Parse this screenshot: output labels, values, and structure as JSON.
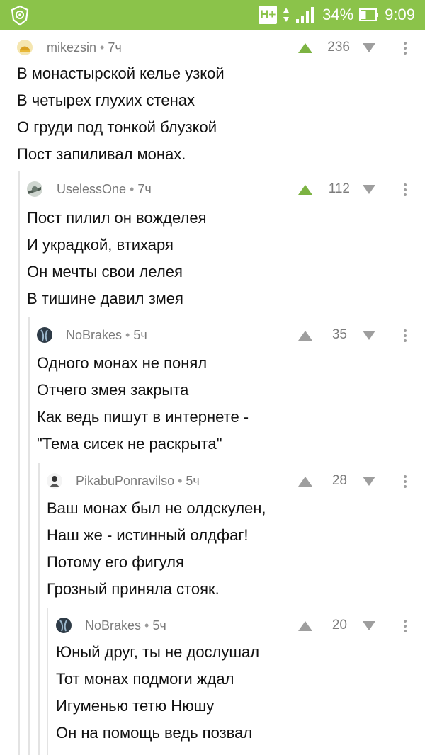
{
  "status_bar": {
    "network": "H+",
    "battery_percent": "34%",
    "time": "9:09",
    "battery_level": 0.34
  },
  "comments": [
    {
      "author": "mikezsin",
      "age": "7ч",
      "rating": "236",
      "upvote_active": true,
      "lines": [
        "В монастырской келье узкой",
        "В четырех глухих стенах",
        "О груди под тонкой блузкой",
        "Пост запиливал монах."
      ]
    },
    {
      "author": "UselessOne",
      "age": "7ч",
      "rating": "112",
      "upvote_active": true,
      "lines": [
        "Пост пилил он вожделея",
        "И украдкой, втихаря",
        "Он мечты свои лелея",
        "В тишине давил змея"
      ]
    },
    {
      "author": "NoBrakes",
      "age": "5ч",
      "rating": "35",
      "upvote_active": false,
      "lines": [
        "Одного монах не понял",
        "Отчего змея закрыта",
        "Как ведь пишут в интернете -",
        "\"Тема сисек не раскрыта\""
      ]
    },
    {
      "author": "PikabuPonravilso",
      "age": "5ч",
      "rating": "28",
      "upvote_active": false,
      "lines": [
        "Ваш монах был не олдскулен,",
        "Наш же - истинный олдфаг!",
        "Потому его фигуля",
        "Грозный приняла стояк."
      ]
    },
    {
      "author": "NoBrakes",
      "age": "5ч",
      "rating": "20",
      "upvote_active": false,
      "lines": [
        "Юный друг, ты не дослушал",
        "Тот монах подмоги ждал",
        "Игуменью тетю Нюшу",
        "Он на помощь ведь позвал"
      ]
    }
  ],
  "colors": {
    "status_bar_bg": "#8bc34a",
    "upvote_active": "#7cb342",
    "upvote_inactive": "#9e9e9e",
    "thread_line": "#e3e3e3"
  }
}
